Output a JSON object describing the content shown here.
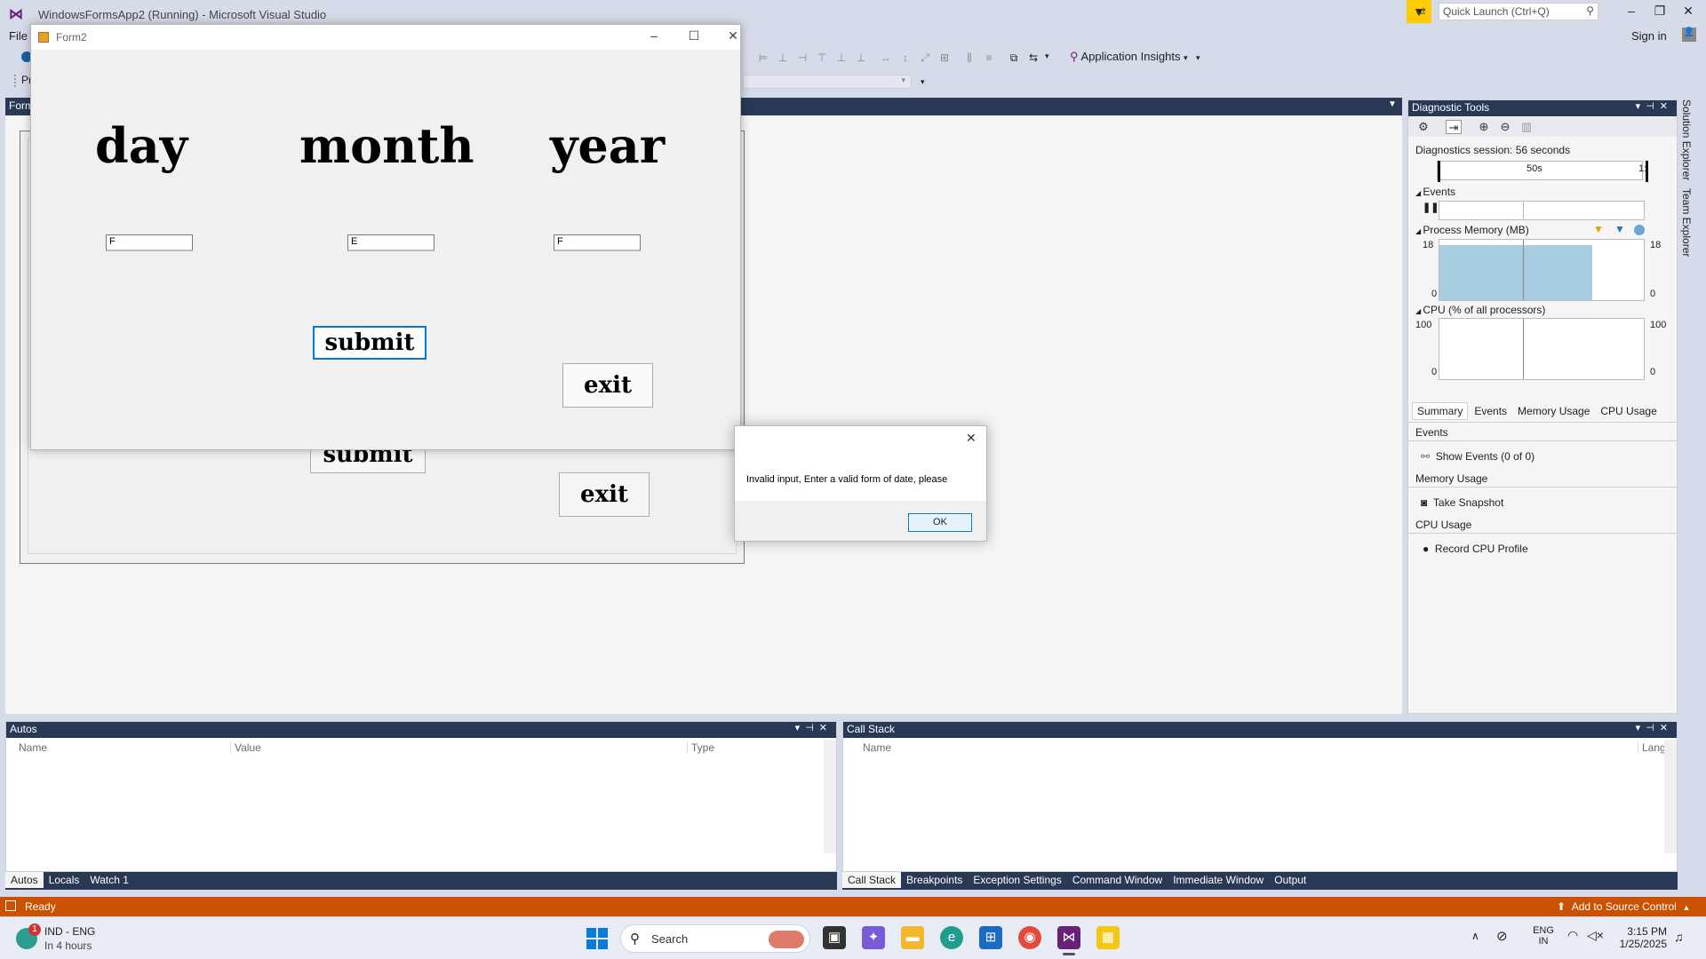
{
  "window": {
    "title": "WindowsFormsApp2 (Running) - Microsoft Visual Studio",
    "quick_launch_placeholder": "Quick Launch (Ctrl+Q)",
    "sign_in": "Sign in"
  },
  "menu": {
    "file": "File"
  },
  "toolbar": {
    "app_insights": "Application Insights",
    "partial": "Pr"
  },
  "doc_tab": {
    "label": "Form"
  },
  "designer": {
    "submit_label": "submit",
    "exit_label": "exit"
  },
  "form2": {
    "title": "Form2",
    "labels": {
      "day": "day",
      "month": "month",
      "year": "year"
    },
    "inputs": {
      "day_value": "F",
      "month_value": "E",
      "year_value": "F"
    },
    "submit_label": "submit",
    "exit_label": "exit"
  },
  "message_box": {
    "text": "Invalid input, Enter a valid form of date, please",
    "ok_label": "OK"
  },
  "diagnostics": {
    "title": "Diagnostic Tools",
    "session": "Diagnostics session: 56 seconds",
    "timeline_label": "50s",
    "timeline_label_right": "1:",
    "events_title": "Events",
    "memory_title": "Process Memory (MB)",
    "memory_max": "18",
    "memory_min": "0",
    "cpu_title": "CPU (% of all processors)",
    "cpu_max": "100",
    "cpu_min": "0",
    "tabs": [
      "Summary",
      "Events",
      "Memory Usage",
      "CPU Usage"
    ],
    "events_section": "Events",
    "show_events": "Show Events (0 of 0)",
    "memory_section": "Memory Usage",
    "take_snapshot": "Take Snapshot",
    "cpu_section": "CPU Usage",
    "record_cpu": "Record CPU Profile"
  },
  "side_tabs": {
    "solution_explorer": "Solution Explorer",
    "team_explorer": "Team Explorer"
  },
  "autos": {
    "title": "Autos",
    "columns": [
      "Name",
      "Value",
      "Type"
    ],
    "tabs": [
      "Autos",
      "Locals",
      "Watch 1"
    ]
  },
  "callstack": {
    "title": "Call Stack",
    "columns": [
      "Name",
      "Lang"
    ],
    "tabs": [
      "Call Stack",
      "Breakpoints",
      "Exception Settings",
      "Command Window",
      "Immediate Window",
      "Output"
    ]
  },
  "status": {
    "ready": "Ready",
    "source_control": "Add to Source Control"
  },
  "taskbar": {
    "notif_count": "1",
    "lang_line1": "IND - ENG",
    "lang_line2": "In 4 hours",
    "search_placeholder": "Search",
    "tray_lang1": "ENG",
    "tray_lang2": "IN",
    "time": "3:15 PM",
    "date": "1/25/2025"
  }
}
